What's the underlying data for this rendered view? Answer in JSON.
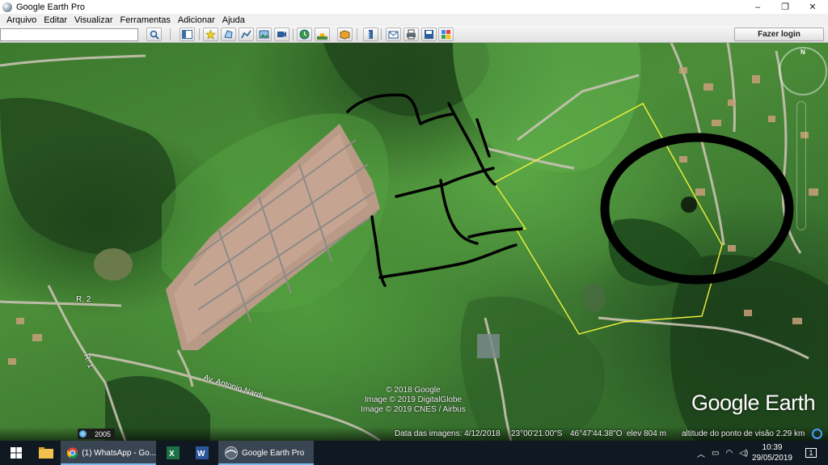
{
  "window": {
    "title": "Google Earth Pro",
    "minimize": "–",
    "maximize": "❐",
    "close": "✕"
  },
  "menu": [
    "Arquivo",
    "Editar",
    "Visualizar",
    "Ferramentas",
    "Adicionar",
    "Ajuda"
  ],
  "toolbar": {
    "search_value": "",
    "login_label": "Fazer login",
    "icons": [
      "search-icon",
      "sidebar-icon",
      "placemark-icon",
      "polygon-icon",
      "path-icon",
      "image-overlay-icon",
      "record-tour-icon",
      "historical-imagery-icon",
      "sunlight-icon",
      "planets-icon",
      "ruler-icon",
      "email-icon",
      "print-icon",
      "save-image-icon",
      "view-in-maps-icon"
    ]
  },
  "map": {
    "road_label_1": "R. 2",
    "road_label_2": "R. 1",
    "road_label_3": "Av. Antonio Nardi",
    "copyright": [
      "© 2018 Google",
      "Image © 2019 DigitalGlobe",
      "Image © 2019 CNES / Airbus"
    ],
    "brand": "Google Earth",
    "historical_year": "2005",
    "north_indicator": "N"
  },
  "status": {
    "imagery_date": "Data das imagens: 4/12/2018",
    "latitude": "23°00'21.00\"S",
    "longitude": "46°47'44.38\"O",
    "elevation": "elev  804 m",
    "eye_altitude": "altitude do ponto de visão  2.29 km"
  },
  "taskbar": {
    "items": [
      {
        "label": "(1) WhatsApp - Go...",
        "icon": "chrome-icon"
      },
      {
        "label": "Google Earth Pro",
        "icon": "google-earth-icon"
      }
    ],
    "clock_time": "10:39",
    "clock_date": "29/05/2019",
    "notification_count": "1"
  },
  "colors": {
    "boundary_line": "#f2f23a",
    "annotation_ink": "#000000",
    "taskbar_bg": "#101821",
    "taskbar_accent": "#76b9ed"
  }
}
